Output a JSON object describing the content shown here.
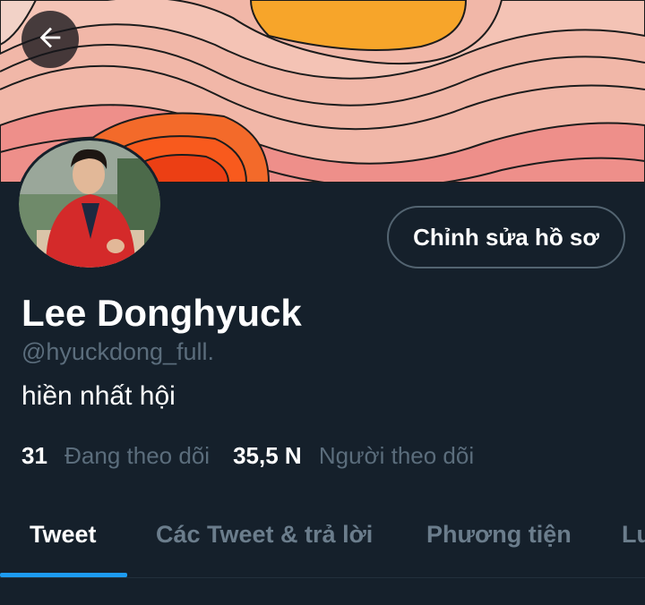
{
  "header": {
    "back_icon": "arrow-left-icon"
  },
  "profile": {
    "edit_button_label": "Chỉnh sửa hồ sơ",
    "display_name": "Lee Donghyuck",
    "handle": "@hyuckdong_full.",
    "bio": "hiền nhất hội"
  },
  "stats": {
    "following_count": "31",
    "following_label": "Đang theo dõi",
    "followers_count": "35,5 N",
    "followers_label": "Người theo dõi"
  },
  "tabs": [
    {
      "label": "Tweet",
      "active": true
    },
    {
      "label": "Các Tweet & trả lời",
      "active": false
    },
    {
      "label": "Phương tiện",
      "active": false
    },
    {
      "label": "Lư",
      "active": false
    }
  ],
  "colors": {
    "background": "#15202b",
    "accent": "#1d9bf0",
    "muted_text": "#5b6d7c"
  }
}
